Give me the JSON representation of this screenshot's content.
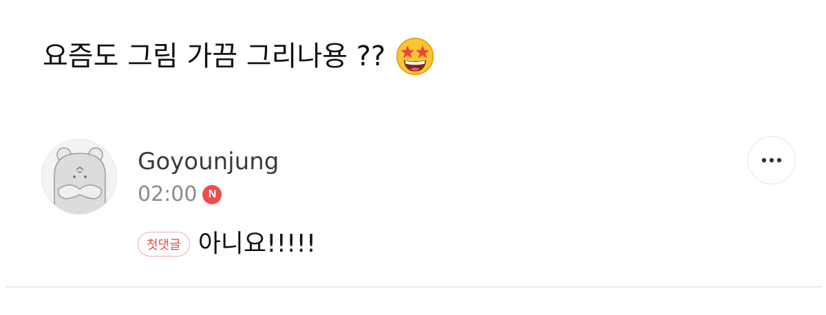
{
  "post": {
    "text": "요즘도 그림 가끔 그리나용 ??",
    "emoji_icon": "star-struck-emoji"
  },
  "comment": {
    "author": "Goyounjung",
    "time": "02:00",
    "new_badge": "N",
    "first_comment_badge": "첫댓글",
    "text": "아니요!!!!!",
    "more_icon": "more-options-icon"
  },
  "colors": {
    "badge_red": "#ef4c4c",
    "badge_outline": "#f2a7a7",
    "meta_gray": "#8a8a8a"
  }
}
